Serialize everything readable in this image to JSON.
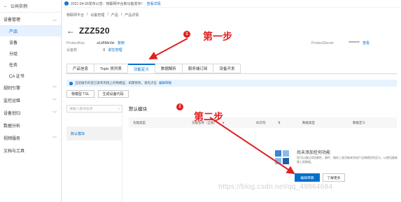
{
  "sidebar": {
    "top_label": "公共实例",
    "sections": [
      {
        "label": "设备管理",
        "expanded": true
      },
      {
        "label": "规则引擎"
      },
      {
        "label": "监控运维"
      },
      {
        "label": "设备划归"
      },
      {
        "label": "数据分析"
      },
      {
        "label": "视频服务"
      },
      {
        "label": "文档与工具"
      }
    ],
    "sub_items": [
      "产品",
      "设备",
      "分组",
      "任务",
      "CA 证书"
    ]
  },
  "notice": {
    "text": "2021-04-30发布公告：物联网平台新功能发布！",
    "link": "查看详情"
  },
  "breadcrumb": [
    "物联网平台",
    "/",
    "设备管理",
    "/",
    "产品",
    "/",
    "产品详情"
  ],
  "title": "ZZZ520",
  "meta": {
    "productkey_label": "ProductKey",
    "productkey_value": "a1cBMeVei",
    "copy_label": "复制",
    "device_count_label": "设备数",
    "device_count_value": "0",
    "device_count_link": "前往管理",
    "productsecret_label": "ProductSecret",
    "productsecret_value": "********",
    "productsecret_link": "查看"
  },
  "tabs": [
    "产品信息",
    "Topic 类列表",
    "功能定义",
    "数据解析",
    "服务端订阅",
    "设备开发"
  ],
  "active_tab": "功能定义",
  "alert": {
    "text": "当前展示的是已发布到线上的物模型，如需修改，请先点击",
    "link": "编辑草稿"
  },
  "buttons": {
    "tsl": "物模型 TSL",
    "gen_code": "生成设备代码"
  },
  "search_placeholder": "请输入模块名称",
  "modules": [
    "默认模块"
  ],
  "section_title": "默认模块",
  "table_headers": [
    "功能类型",
    "功能名称（全部）",
    "标识符",
    "数据类型",
    "数据定义"
  ],
  "empty": {
    "title": "尚未添加任何功能",
    "desc": "您可以通过添加属性、事件、服务三类功能来完成产品物模型的定义，以便设备能够上报数据。",
    "primary": "编辑草稿",
    "secondary": "了解更多"
  },
  "annotations": {
    "step1": "第一步",
    "step2": "第二步",
    "badge1": "1",
    "badge2": "2"
  },
  "watermark": "https://blog.csdn.net/qq_49864684",
  "colors": {
    "accent": "#0070cc",
    "annotation": "#e02020"
  }
}
